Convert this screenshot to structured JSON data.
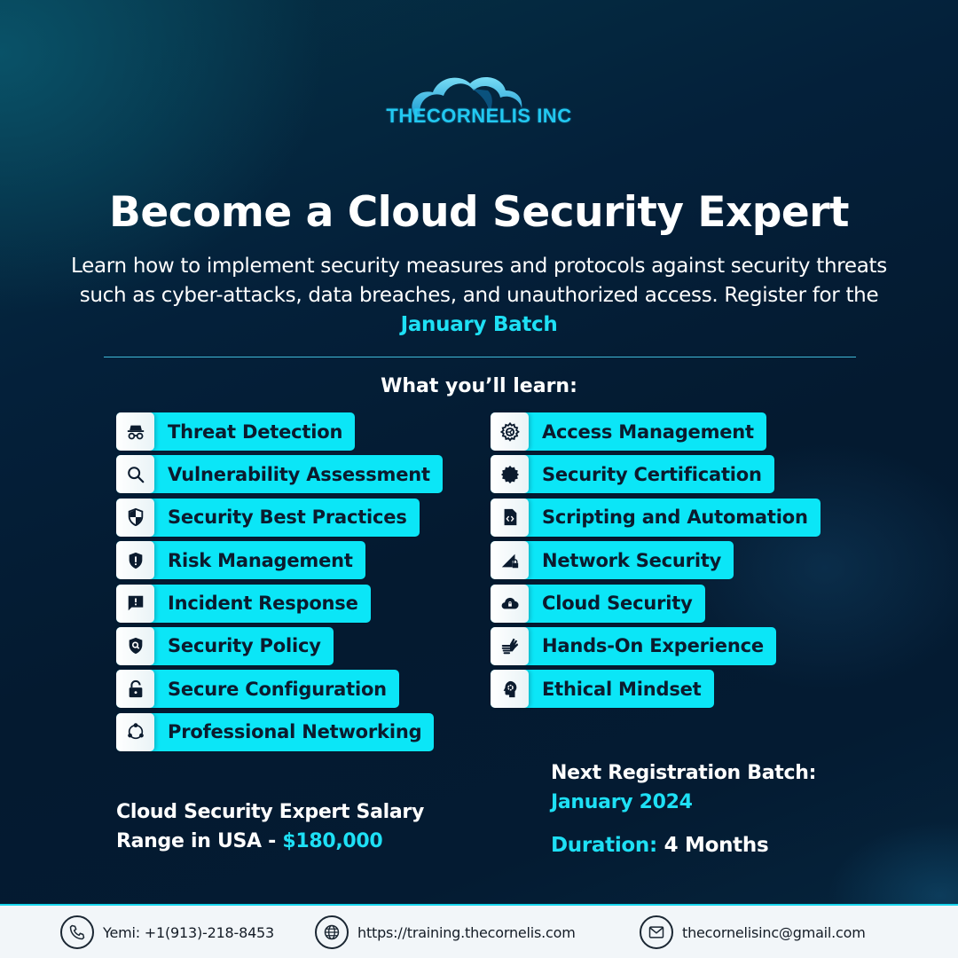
{
  "brand": {
    "name": "THECORNELIS INC",
    "logo_icon": "cloud-logo-icon",
    "accent_color": "#1ee0f5",
    "pill_color": "#0be6f7"
  },
  "hero": {
    "title": "Become a Cloud Security Expert",
    "subtitle_text": "Learn how to implement security measures and protocols against security threats such as cyber-attacks, data breaches, and unauthorized access. Register for the ",
    "subtitle_highlight": "January Batch"
  },
  "learn": {
    "heading": "What you’ll learn:",
    "left": [
      {
        "label": "Threat Detection",
        "icon": "spy-icon"
      },
      {
        "label": "Vulnerability Assessment",
        "icon": "magnifier-icon"
      },
      {
        "label": "Security Best Practices",
        "icon": "shield-half-icon"
      },
      {
        "label": "Risk Management",
        "icon": "shield-exclamation-icon"
      },
      {
        "label": "Incident Response",
        "icon": "chat-alert-icon"
      },
      {
        "label": "Security Policy",
        "icon": "shield-search-icon"
      },
      {
        "label": "Secure Configuration",
        "icon": "unlock-icon"
      },
      {
        "label": "Professional Networking",
        "icon": "network-cycle-icon"
      }
    ],
    "right": [
      {
        "label": "Access Management",
        "icon": "gear-icon"
      },
      {
        "label": "Security Certification",
        "icon": "badge-icon"
      },
      {
        "label": "Scripting and Automation",
        "icon": "code-file-icon"
      },
      {
        "label": "Network Security",
        "icon": "signal-lock-icon"
      },
      {
        "label": "Cloud Security",
        "icon": "cloud-lock-icon"
      },
      {
        "label": "Hands-On Experience",
        "icon": "hands-icon"
      },
      {
        "label": "Ethical Mindset",
        "icon": "head-gear-icon"
      }
    ]
  },
  "salary": {
    "line1": "Cloud Security Expert Salary",
    "line2": "Range in USA - ",
    "amount": "$180,000"
  },
  "batch": {
    "label": "Next Registration Batch:",
    "date": "January 2024",
    "duration_label": "Duration:",
    "duration_value": " 4  Months"
  },
  "footer": {
    "phone": "Yemi: +1(913)-218-8453",
    "website": "https://training.thecornelis.com",
    "email": "thecornelisinc@gmail.com"
  }
}
